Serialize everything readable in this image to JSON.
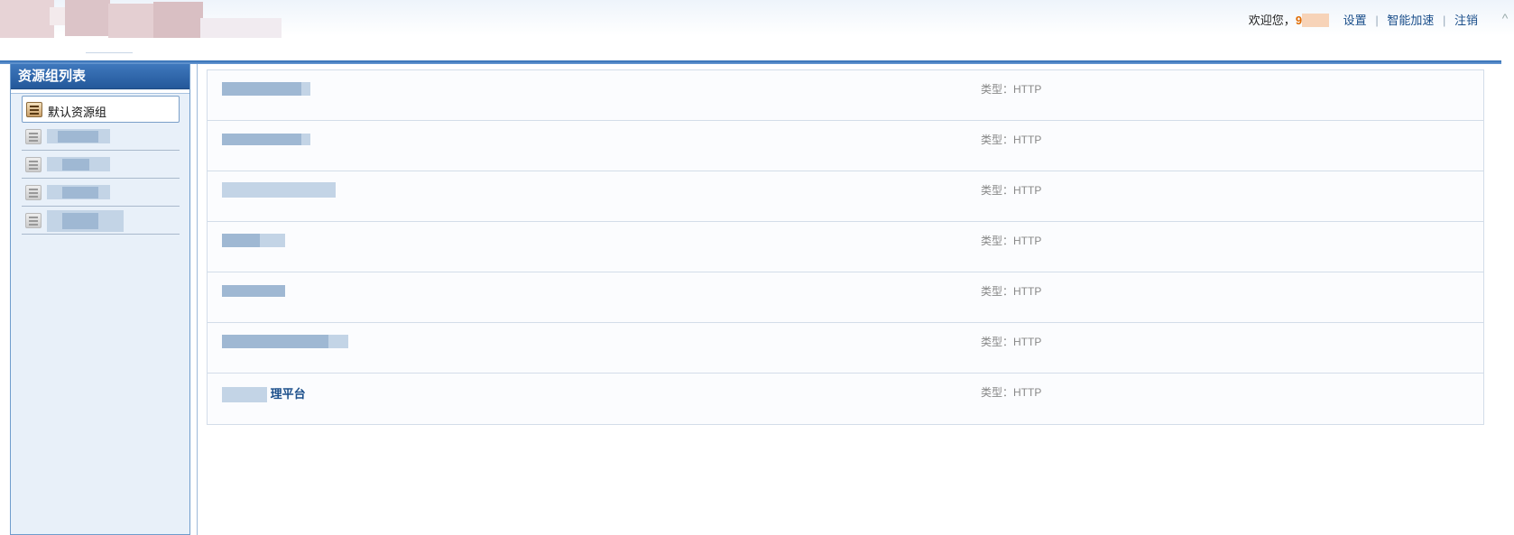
{
  "header": {
    "welcome_prefix": "欢迎您，",
    "username_visible": "9",
    "links": {
      "settings": "设置",
      "smart_accel": "智能加速",
      "logout": "注销"
    },
    "separator": "|"
  },
  "sidebar": {
    "title": "资源组列表",
    "items": [
      {
        "label": "默认资源组",
        "selected": true
      },
      {
        "label": "",
        "selected": false
      },
      {
        "label": "",
        "selected": false
      },
      {
        "label": "",
        "selected": false
      },
      {
        "label": "",
        "selected": false
      }
    ]
  },
  "resources": [
    {
      "name_visible": "",
      "type_label": "类型：",
      "type": "HTTP"
    },
    {
      "name_visible": "",
      "type_label": "类型：",
      "type": "HTTP"
    },
    {
      "name_visible": "",
      "type_label": "类型：",
      "type": "HTTP"
    },
    {
      "name_visible": "",
      "type_label": "类型：",
      "type": "HTTP"
    },
    {
      "name_visible": "",
      "type_label": "类型：",
      "type": "HTTP"
    },
    {
      "name_visible": "",
      "type_label": "类型：",
      "type": "HTTP"
    },
    {
      "name_visible": "理平台",
      "type_label": "类型：",
      "type": "HTTP"
    }
  ],
  "colors": {
    "accent_blue": "#2f6cb3",
    "link": "#1a4e8a",
    "username": "#e06a00"
  }
}
